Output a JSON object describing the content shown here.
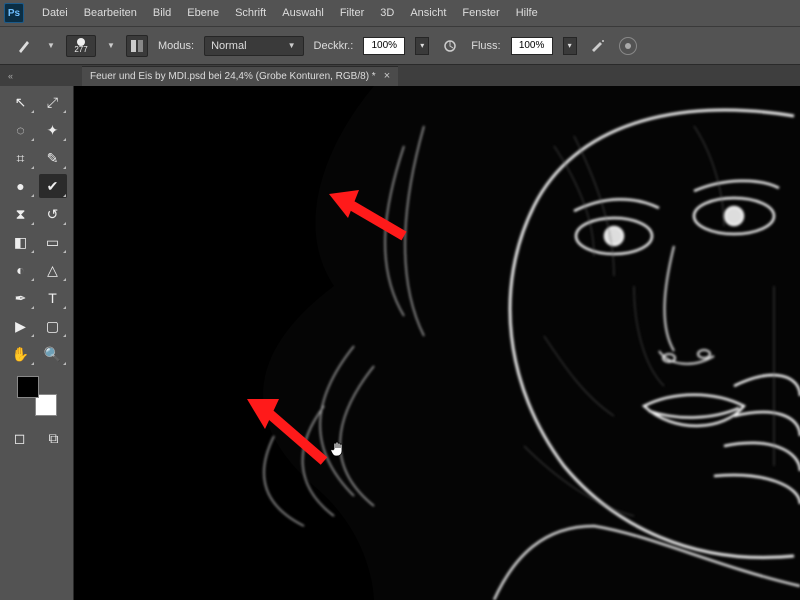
{
  "app": {
    "logo": "Ps"
  },
  "menu": [
    "Datei",
    "Bearbeiten",
    "Bild",
    "Ebene",
    "Schrift",
    "Auswahl",
    "Filter",
    "3D",
    "Ansicht",
    "Fenster",
    "Hilfe"
  ],
  "options": {
    "brush_size": "277",
    "mode_label": "Modus:",
    "mode_value": "Normal",
    "opacity_label": "Deckkr.:",
    "opacity_value": "100%",
    "flow_label": "Fluss:",
    "flow_value": "100%"
  },
  "document": {
    "tab_title": "Feuer und Eis by MDI.psd bei 24,4% (Grobe Konturen, RGB/8) *"
  },
  "tools": {
    "left": [
      {
        "name": "move-tool",
        "icon": "↖"
      },
      {
        "name": "marquee-tool",
        "icon": "◌"
      },
      {
        "name": "crop-tool",
        "icon": "⌗"
      },
      {
        "name": "healing-brush-tool",
        "icon": "●"
      },
      {
        "name": "clone-stamp-tool",
        "icon": "⧗"
      },
      {
        "name": "eraser-tool",
        "icon": "◧"
      },
      {
        "name": "dodge-tool",
        "icon": "◐"
      },
      {
        "name": "pen-tool",
        "icon": "✒"
      },
      {
        "name": "path-select-tool",
        "icon": "▶"
      },
      {
        "name": "hand-tool",
        "icon": "✋"
      }
    ],
    "right": [
      {
        "name": "arrow-tool",
        "icon": "⤢"
      },
      {
        "name": "magic-wand-tool",
        "icon": "✦"
      },
      {
        "name": "eyedropper-tool",
        "icon": "✎"
      },
      {
        "name": "brush-tool",
        "icon": "✔",
        "selected": true
      },
      {
        "name": "history-brush-tool",
        "icon": "↺"
      },
      {
        "name": "gradient-tool",
        "icon": "▭"
      },
      {
        "name": "blur-tool",
        "icon": "△"
      },
      {
        "name": "type-tool",
        "icon": "T"
      },
      {
        "name": "shape-tool",
        "icon": "▢"
      },
      {
        "name": "zoom-tool",
        "icon": "🔍"
      }
    ]
  },
  "colors": {
    "foreground": "#000000",
    "background": "#ffffff",
    "accent_arrow": "#ff1a1a"
  }
}
